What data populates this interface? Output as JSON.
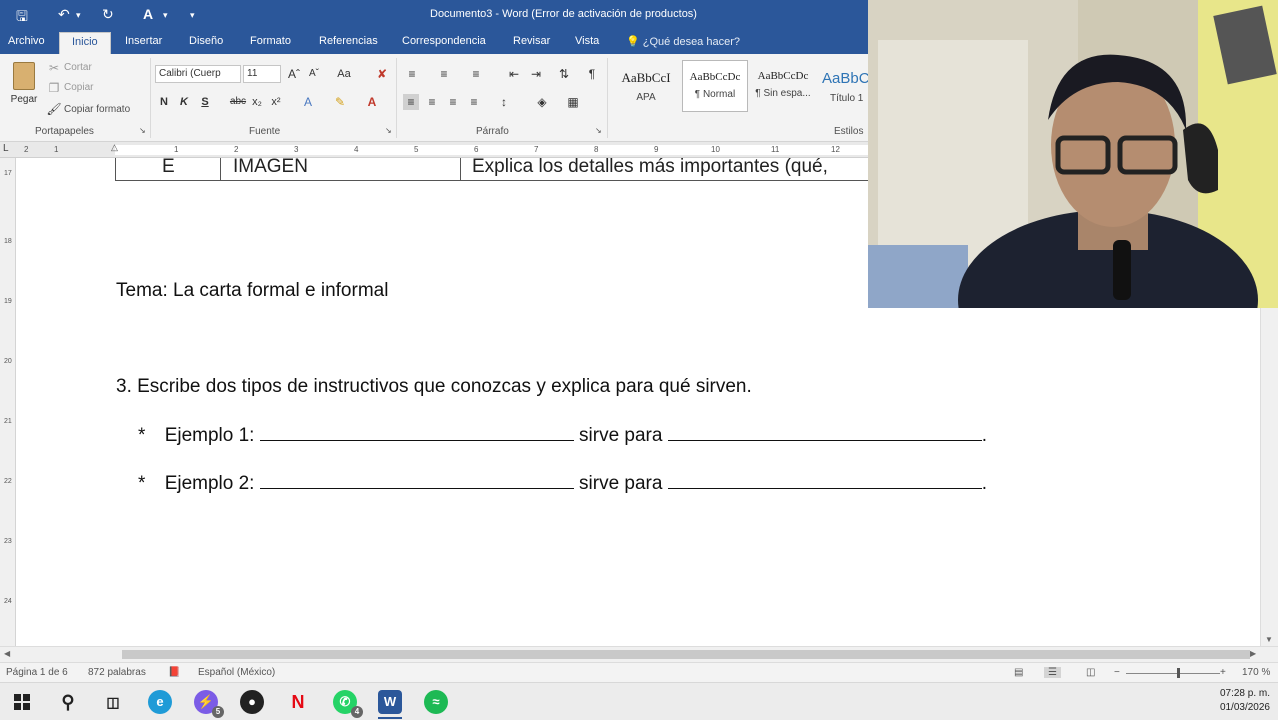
{
  "window": {
    "title": "Documento3 - Word (Error de activación de productos)"
  },
  "tabs": [
    "Archivo",
    "Inicio",
    "Insertar",
    "Diseño",
    "Formato",
    "Referencias",
    "Correspondencia",
    "Revisar",
    "Vista"
  ],
  "active_tab": "Inicio",
  "tell_me": "¿Qué desea hacer?",
  "ribbon": {
    "clipboard": {
      "paste": "Pegar",
      "cut": "Cortar",
      "copy": "Copiar",
      "format_painter": "Copiar formato",
      "label": "Portapapeles"
    },
    "font": {
      "name": "Calibri (Cuerp",
      "size": "11",
      "bold": "N",
      "italic": "K",
      "underline": "S",
      "strike": "abc",
      "subscript": "x₂",
      "superscript": "x²",
      "label": "Fuente",
      "case": "Aa"
    },
    "paragraph": {
      "label": "Párrafo"
    },
    "styles": {
      "items": [
        {
          "preview": "AaBbCcI",
          "name": "APA"
        },
        {
          "preview": "AaBbCcDc",
          "name": "¶ Normal"
        },
        {
          "preview": "AaBbCcDc",
          "name": "¶ Sin espa..."
        },
        {
          "preview": "AaBbC",
          "name": "Título 1"
        }
      ],
      "label": "Estilos"
    }
  },
  "ruler_numbers": [
    "2",
    "1",
    "1",
    "2",
    "3",
    "4",
    "5",
    "6",
    "7",
    "8",
    "9",
    "10",
    "11",
    "12"
  ],
  "vruler_numbers": [
    "17",
    "18",
    "19",
    "20",
    "21",
    "22",
    "23",
    "24"
  ],
  "document": {
    "table_row": {
      "col1": "E",
      "col2": "IMAGEN",
      "col3": "Explica los detalles más importantes (qué,"
    },
    "tema": "Tema: La carta formal e informal",
    "question": "3.  Escribe dos tipos de instructivos que conozcas y explica para qué sirven.",
    "bullet": "*",
    "examples": [
      {
        "label": "Ejemplo 1:",
        "middle": "sirve para",
        "end": "."
      },
      {
        "label": "Ejemplo 2:",
        "middle": "sirve para",
        "end": "."
      }
    ]
  },
  "status": {
    "page": "Página 1 de 6",
    "words": "872 palabras",
    "language": "Español (México)",
    "zoom": "170 %"
  },
  "taskbar": {
    "icons": [
      "windows-icon",
      "search-icon",
      "task-view-icon",
      "edge-icon",
      "messenger-icon",
      "app-icon",
      "netflix-icon",
      "whatsapp-icon",
      "word-icon",
      "spotify-icon"
    ],
    "messenger_badge": "5",
    "whatsapp_badge": "4",
    "netflix_letter": "N",
    "word_letter": "W",
    "time": "07:28 p. m.",
    "date": "01/03/2026"
  },
  "colors": {
    "word_blue": "#2b579a",
    "ribbon_bg": "#f3f3f3",
    "page_bg": "#ffffff"
  }
}
